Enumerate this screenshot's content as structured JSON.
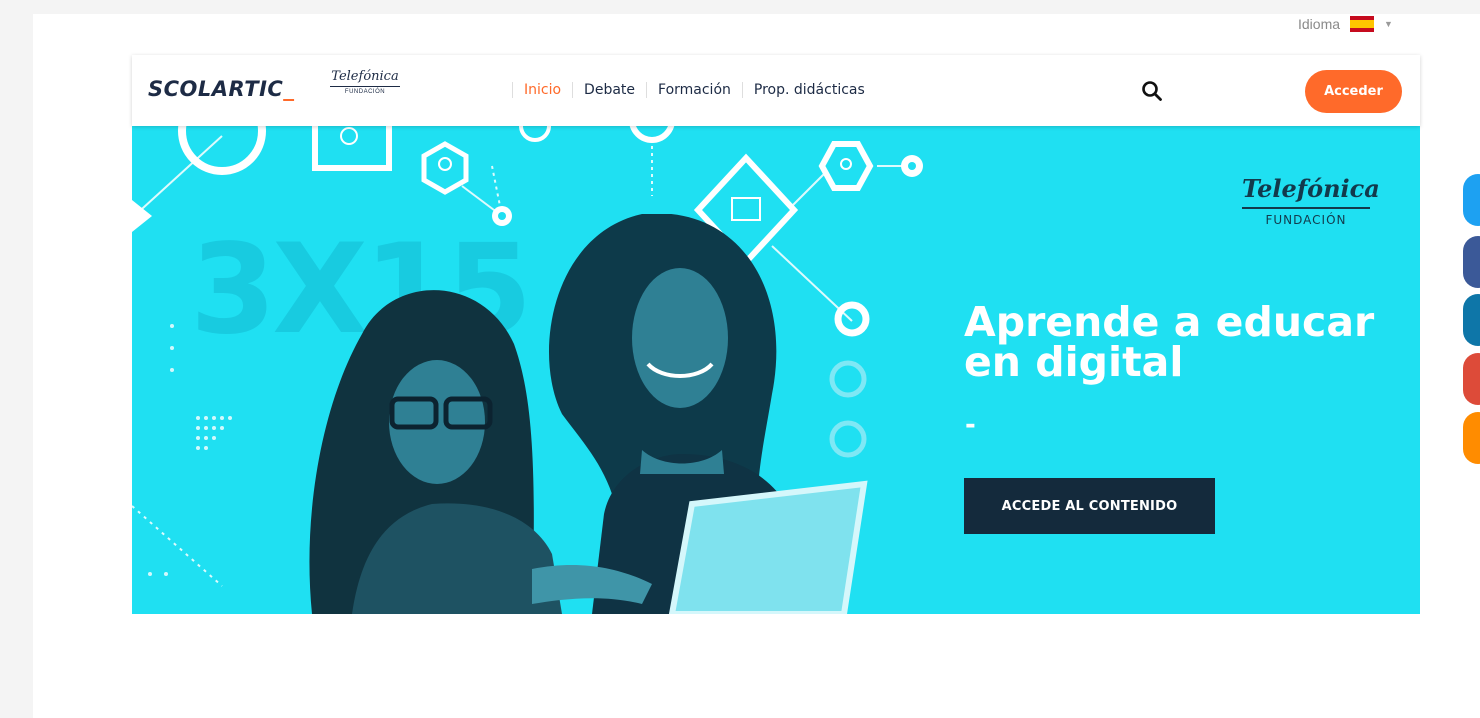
{
  "language": {
    "label": "Idioma",
    "flag_icon": "spain-flag-icon"
  },
  "navbar": {
    "logo_text": "SCOLARTIC",
    "logo_underscore": "_",
    "partner_logo": {
      "name": "Telefónica",
      "sub": "FUNDACIÓN"
    },
    "links": [
      {
        "label": "Inicio",
        "active": true
      },
      {
        "label": "Debate",
        "active": false
      },
      {
        "label": "Formación",
        "active": false
      },
      {
        "label": "Prop. didácticas",
        "active": false
      }
    ],
    "search_icon": "search-icon",
    "login_label": "Acceder"
  },
  "hero": {
    "background_text": "3X15",
    "title": "Aprende a educar en digital",
    "dash": "-",
    "cta_label": "ACCEDE AL CONTENIDO",
    "brand": {
      "name": "Telefónica",
      "sub": "FUNDACIÓN"
    }
  },
  "social_buttons": [
    {
      "icon": "twitter-icon",
      "color": "#1da1f2"
    },
    {
      "icon": "facebook-icon",
      "color": "#3b5998"
    },
    {
      "icon": "linkedin-icon",
      "color": "#0e76a8"
    },
    {
      "icon": "google-plus-icon",
      "color": "#dd4b39"
    },
    {
      "icon": "share-icon",
      "color": "#ff8c00"
    }
  ],
  "colors": {
    "accent": "#ff6a2a",
    "hero_bg": "#1fe0f2",
    "cta_bg": "#142a3c",
    "navy": "#1d2b45"
  }
}
